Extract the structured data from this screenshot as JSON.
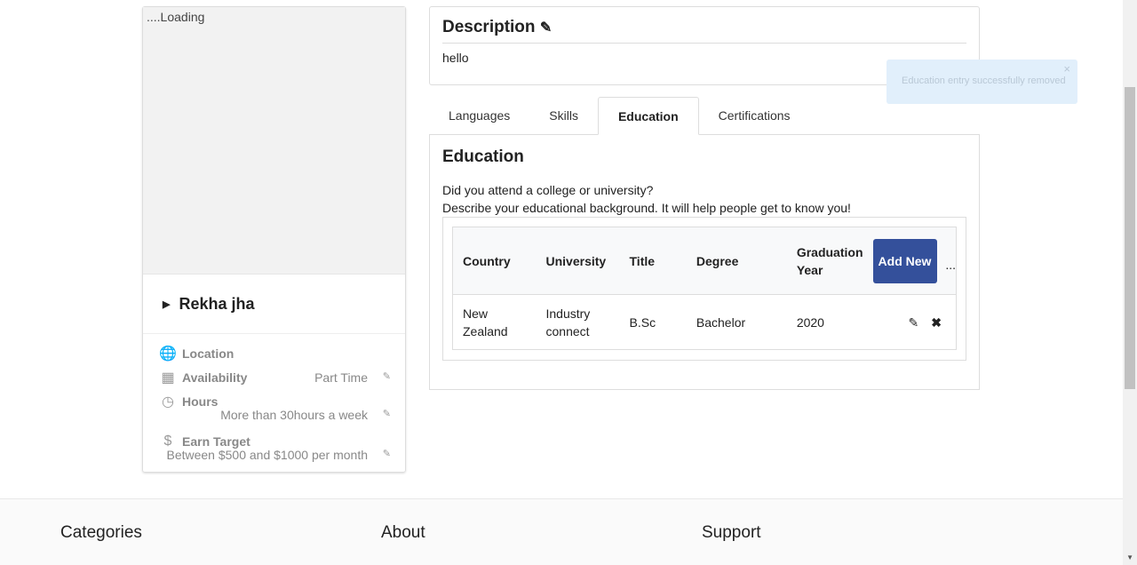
{
  "profile": {
    "image_alt": "....Loading",
    "name": "Rekha jha",
    "info": [
      {
        "icon": "globe-icon",
        "label": "Location",
        "value": ""
      },
      {
        "icon": "calendar-icon",
        "label": "Availability",
        "value": "Part Time"
      },
      {
        "icon": "clock-icon",
        "label": "Hours",
        "value": "More than 30hours a week"
      },
      {
        "icon": "dollar-icon",
        "label": "Earn Target",
        "value": "Between $500 and $1000 per month"
      }
    ]
  },
  "description": {
    "title": "Description",
    "text": "hello"
  },
  "tabs": [
    "Languages",
    "Skills",
    "Education",
    "Certifications"
  ],
  "active_tab": "Education",
  "education": {
    "title": "Education",
    "line1": "Did you attend a college or university?",
    "line2": "Describe your educational background. It will help people get to know you!",
    "columns": [
      "Country",
      "University",
      "Title",
      "Degree",
      "Graduation Year"
    ],
    "add_label": "Add New",
    "more": "...",
    "rows": [
      {
        "country": "New Zealand",
        "university": "Industry connect",
        "title": "B.Sc",
        "degree": "Bachelor",
        "year": "2020"
      }
    ]
  },
  "toast": {
    "message": "Education entry successfully removed",
    "close": "×"
  },
  "footer": {
    "headings": [
      "Categories",
      "About",
      "Support"
    ]
  },
  "colors": {
    "primary": "#34509b",
    "toast_bg": "#e1effb"
  }
}
